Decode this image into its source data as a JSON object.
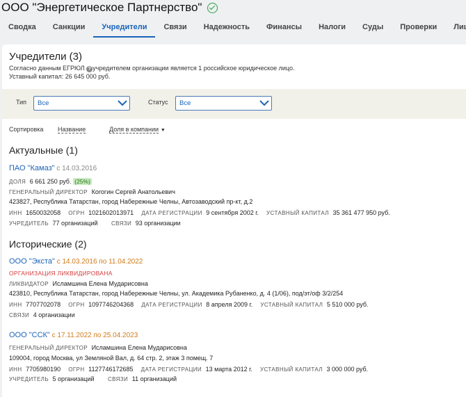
{
  "company": {
    "title": "ООО \"Энергетическое Партнерство\""
  },
  "tabs": [
    "Сводка",
    "Санкции",
    "Учредители",
    "Связи",
    "Надежность",
    "Финансы",
    "Налоги",
    "Суды",
    "Проверки",
    "Лицен"
  ],
  "active_tab": "Учредители",
  "section": {
    "title": "Учредители (3)",
    "line1_before": "Согласно данным ЕГРЮЛ ",
    "line1_after": "учредителем организации является 1 российское юридическое лицо.",
    "line2": "Уставный капитал: 26 645 000 руб."
  },
  "filters": {
    "type_label": "Тип",
    "type_value": "Все",
    "status_label": "Статус",
    "status_value": "Все"
  },
  "sort": {
    "label": "Сортировка",
    "option1": "Название",
    "option2": "Доля в компании"
  },
  "actual": {
    "heading": "Актуальные (1)",
    "item": {
      "name": "ПАО \"Камаз\"",
      "since": "с 14.03.2016",
      "share_label": "ДОЛЯ",
      "share_value": "6 661 250 руб.",
      "share_pct": "(25%)",
      "director_label": "ГЕНЕРАЛЬНЫЙ ДИРЕКТОР",
      "director": "Когогин Сергей Анатольевич",
      "address": "423827, Республика Татарстан, город Набережные Челны, Автозаводский пр-кт, д.2",
      "inn_label": "ИНН",
      "inn": "1650032058",
      "ogrn_label": "ОГРН",
      "ogrn": "1021602013971",
      "reg_label": "ДАТА РЕГИСТРАЦИИ",
      "reg": "9 сентября 2002 г.",
      "cap_label": "УСТАВНЫЙ КАПИТАЛ",
      "cap": "35 361 477 950 руб.",
      "founder_label": "УЧРЕДИТЕЛЬ",
      "founder_link": "77 организаций",
      "links_label": "СВЯЗИ",
      "links_link": "93 организации"
    }
  },
  "historic": {
    "heading": "Исторические (2)",
    "item1": {
      "name": "ООО \"Экста\"",
      "period": "с 14.03.2016 по 11.04.2022",
      "status": "ОРГАНИЗАЦИЯ ЛИКВИДИРОВАНА",
      "role_label": "ЛИКВИДАТОР",
      "role_person": "Исламшина Елена Мударисовна",
      "address": "423810, Республика Татарстан, город Набережные Челны, ул. Академика Рубаненко, д. 4 (1/06), под/эт/оф 3/2/254",
      "inn_label": "ИНН",
      "inn": "7707702078",
      "ogrn_label": "ОГРН",
      "ogrn": "1097746204368",
      "reg_label": "ДАТА РЕГИСТРАЦИИ",
      "reg": "8 апреля 2009 г.",
      "cap_label": "УСТАВНЫЙ КАПИТАЛ",
      "cap": "5 510 000 руб.",
      "links_label": "СВЯЗИ",
      "links_link": "4 организации"
    },
    "item2": {
      "name": "ООО \"ССК\"",
      "period": "с 17.11.2022 по 25.04.2023",
      "role_label": "ГЕНЕРАЛЬНЫЙ ДИРЕКТОР",
      "role_person": "Исламшина Елена Мударисовна",
      "address": "109004, город Москва, ул Земляной Вал, д. 64 стр. 2, этаж 3 помещ. 7",
      "inn_label": "ИНН",
      "inn": "7705980190",
      "ogrn_label": "ОГРН",
      "ogrn": "1127746172685",
      "reg_label": "ДАТА РЕГИСТРАЦИИ",
      "reg": "13 марта 2012 г.",
      "cap_label": "УСТАВНЫЙ КАПИТАЛ",
      "cap": "3 000 000 руб.",
      "founder_label": "УЧРЕДИТЕЛЬ",
      "founder_link": "5 организаций",
      "links_label": "СВЯЗИ",
      "links_link": "11 организаций"
    }
  },
  "colors": {
    "accent": "#1a63b8",
    "verified": "#2e9c47",
    "period": "#d07a19",
    "liquidated": "#d43a3a",
    "share_badge": "#c8ecc0"
  },
  "icons": {
    "verified": "check-circle-icon",
    "help": "question-icon",
    "dropdown": "chevron-down-icon",
    "sort_caret": "caret-down-icon"
  }
}
